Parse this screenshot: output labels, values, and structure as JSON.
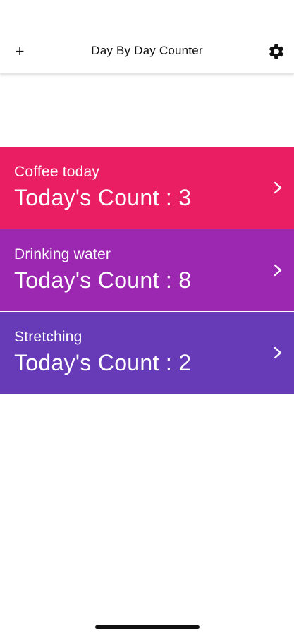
{
  "navbar": {
    "add_icon": "plus-icon",
    "add_glyph": "+",
    "title": "Day By Day Counter",
    "settings_icon": "gear-icon"
  },
  "counters": [
    {
      "name": "Coffee today",
      "count_label": "Today's Count : 3",
      "count": 3,
      "color": "#E91E63"
    },
    {
      "name": "Drinking water",
      "count_label": "Today's Count : 8",
      "count": 8,
      "color": "#9C27B0"
    },
    {
      "name": "Stretching",
      "count_label": "Today's Count : 2",
      "count": 2,
      "color": "#673AB7"
    }
  ],
  "icons": {
    "row_chevron": "chevron-right-icon"
  }
}
